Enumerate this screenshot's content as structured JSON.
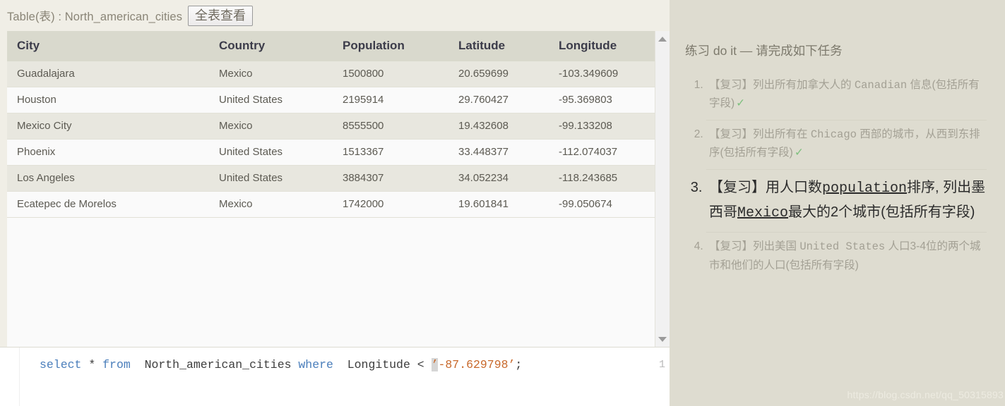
{
  "topbar": {
    "table_label": "Table(表) : North_american_cities",
    "view_all_button": "全表查看"
  },
  "table": {
    "columns": [
      "City",
      "Country",
      "Population",
      "Latitude",
      "Longitude"
    ],
    "rows": [
      [
        "Guadalajara",
        "Mexico",
        "1500800",
        "20.659699",
        "-103.349609"
      ],
      [
        "Houston",
        "United States",
        "2195914",
        "29.760427",
        "-95.369803"
      ],
      [
        "Mexico City",
        "Mexico",
        "8555500",
        "19.432608",
        "-99.133208"
      ],
      [
        "Phoenix",
        "United States",
        "1513367",
        "33.448377",
        "-112.074037"
      ],
      [
        "Los Angeles",
        "United States",
        "3884307",
        "34.052234",
        "-118.243685"
      ],
      [
        "Ecatepec de Morelos",
        "Mexico",
        "1742000",
        "19.601841",
        "-99.050674"
      ]
    ]
  },
  "scrollbar": {
    "up_arrow": "▲",
    "down_arrow": "▼"
  },
  "editor": {
    "line_number": "1",
    "tokens": {
      "kw_select": "select",
      "star": "* ",
      "kw_from": "from",
      "table_name": "North_american_cities",
      "kw_where": "where",
      "column": "Longitude",
      "operator": "<",
      "quote_open": "’",
      "value": "-87.629798",
      "quote_close": "’",
      "semicolon": ";"
    },
    "full_text": "select * from  North_american_cities where  Longitude < ’-87.629798’;"
  },
  "sidepanel": {
    "title": "练习 do it — 请完成如下任务",
    "tasks": [
      {
        "n": 1,
        "text_a": "【复习】列出所有加拿大人的 ",
        "mono": "Canadian",
        "text_b": " 信息(包括所有字段)",
        "done": "✓",
        "active": false
      },
      {
        "n": 2,
        "text_a": "【复习】列出所有在 ",
        "mono": "Chicago",
        "text_b": " 西部的城市，从西到东排序(包括所有字段)",
        "done": "✓",
        "active": false
      },
      {
        "n": 3,
        "text_a": "【复习】用人口数",
        "mono": "population",
        "text_b": "排序, 列出墨西哥",
        "mono2": "Mexico",
        "text_c": "最大的2个城市(包括所有字段)",
        "done": "",
        "active": true
      },
      {
        "n": 4,
        "text_a": "【复习】列出美国 ",
        "mono": "United States",
        "text_b": " 人口3-4位的两个城市和他们的人口(包括所有字段)",
        "done": "",
        "active": false
      }
    ]
  },
  "watermark": "https://blog.csdn.net/qq_50315893"
}
